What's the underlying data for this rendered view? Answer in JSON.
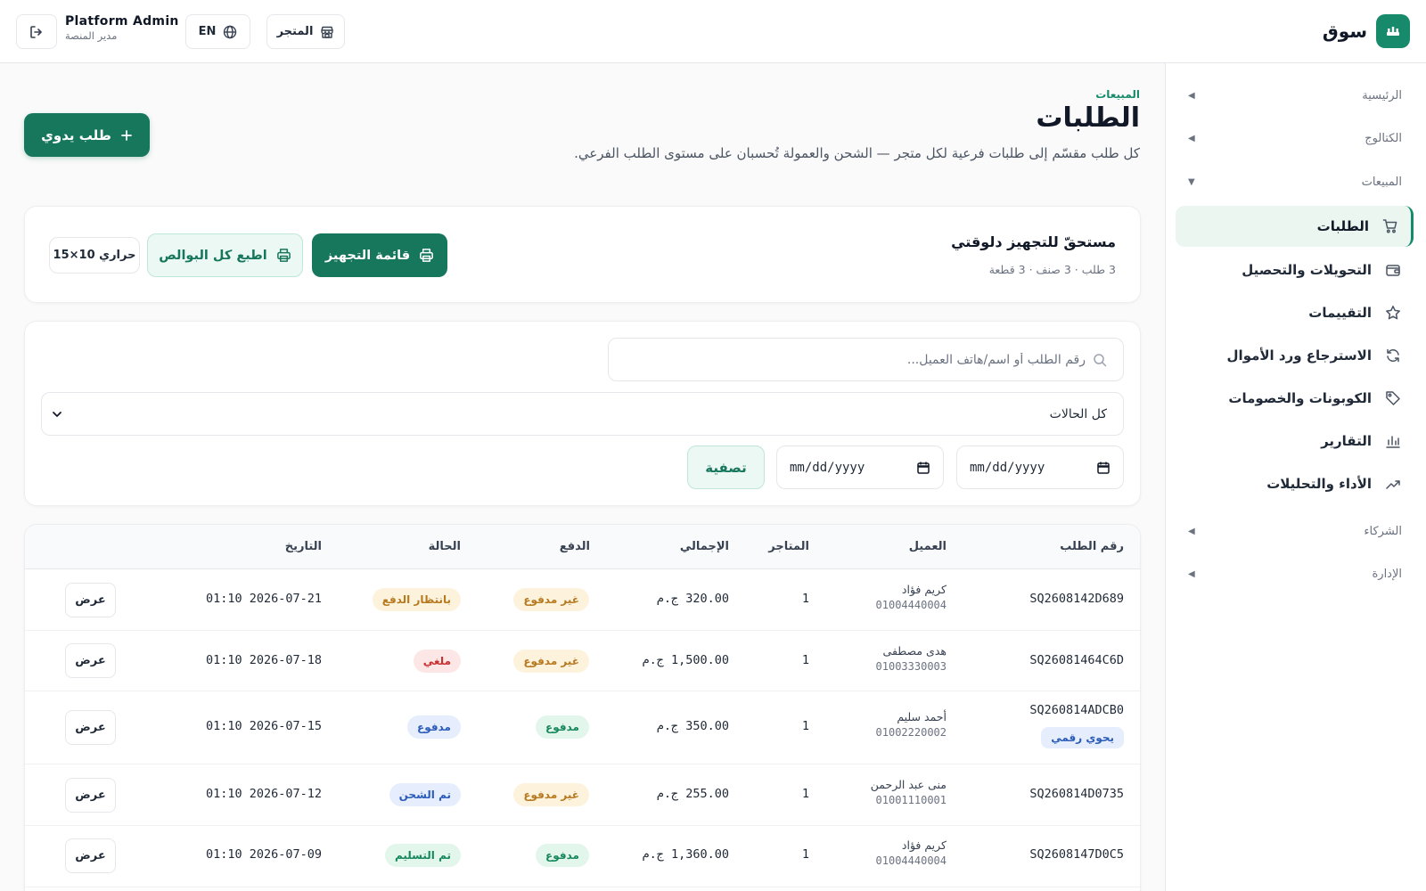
{
  "header": {
    "brand_name": "سوق",
    "store_label": "المتجر",
    "lang_label": "EN",
    "admin_name": "Platform Admin",
    "admin_role": "مدير المنصة"
  },
  "sidebar": {
    "sections": [
      {
        "label": "الرئيسية",
        "caret": "◀"
      },
      {
        "label": "الكتالوج",
        "caret": "◀"
      },
      {
        "label": "المبيعات",
        "caret": "▼"
      },
      {
        "label": "الشركاء",
        "caret": "◀"
      },
      {
        "label": "الإدارة",
        "caret": "◀"
      }
    ],
    "items": [
      {
        "label": "الطلبات",
        "icon": "cart-icon",
        "active": true
      },
      {
        "label": "التحويلات والتحصيل",
        "icon": "wallet-icon"
      },
      {
        "label": "التقييمات",
        "icon": "star-icon"
      },
      {
        "label": "الاسترجاع ورد الأموال",
        "icon": "refresh-icon"
      },
      {
        "label": "الكوبونات والخصومات",
        "icon": "tag-icon"
      },
      {
        "label": "التقارير",
        "icon": "bar-chart-icon"
      },
      {
        "label": "الأداء والتحليلات",
        "icon": "trend-icon"
      }
    ]
  },
  "page": {
    "breadcrumb": "المبيعات",
    "title": "الطلبات",
    "description": "كل طلب مقسّم إلى طلبات فرعية لكل متجر — الشحن والعمولة تُحسبان على مستوى الطلب الفرعي.",
    "new_order_label": "طلب يدوي"
  },
  "prep": {
    "title": "مستحقّ للتجهيز دلوقتي",
    "meta": "3 طلب · 3 صنف · 3 قطعة",
    "list_label": "قائمة التجهيز",
    "print_label": "اطبع كل البوالص",
    "thermal_label": "حراري 10×15"
  },
  "filters": {
    "search_placeholder": "رقم الطلب أو اسم/هاتف العميل...",
    "status_value": "كل الحالات",
    "date_from_placeholder": "mm/dd/yyyy",
    "date_to_placeholder": "mm/dd/yyyy",
    "filter_label": "تصفية"
  },
  "table": {
    "columns": [
      "رقم الطلب",
      "العميل",
      "المتاجر",
      "الإجمالي",
      "الدفع",
      "الحالة",
      "التاريخ"
    ],
    "view_label": "عرض",
    "rows": [
      {
        "id": "SQ2608142D689",
        "customer": "كريم فؤاد",
        "phone": "01004440004",
        "stores": "1",
        "total": "320.00 ج.م",
        "payment": "غير مدفوع",
        "payment_kind": "unpaid",
        "status": "بانتظار الدفع",
        "status_kind": "awaiting",
        "date": "2026-07-21 01:10"
      },
      {
        "id": "SQ26081464C6D",
        "customer": "هدى مصطفى",
        "phone": "01003330003",
        "stores": "1",
        "total": "1,500.00 ج.م",
        "payment": "غير مدفوع",
        "payment_kind": "unpaid",
        "status": "ملغي",
        "status_kind": "cancelled",
        "date": "2026-07-18 01:10"
      },
      {
        "id": "SQ260814ADCB0",
        "tag": "يحوي رقمي",
        "customer": "أحمد سليم",
        "phone": "01002220002",
        "stores": "1",
        "total": "350.00 ج.م",
        "payment": "مدفوع",
        "payment_kind": "paid",
        "status": "مدفوع",
        "status_kind": "paidstatus",
        "date": "2026-07-15 01:10"
      },
      {
        "id": "SQ260814D0735",
        "customer": "منى عبد الرحمن",
        "phone": "01001110001",
        "stores": "1",
        "total": "255.00 ج.م",
        "payment": "غير مدفوع",
        "payment_kind": "unpaid",
        "status": "تم الشحن",
        "status_kind": "shipped",
        "date": "2026-07-12 01:10"
      },
      {
        "id": "SQ2608147D0C5",
        "customer": "كريم فؤاد",
        "phone": "01004440004",
        "stores": "1",
        "total": "1,360.00 ج.م",
        "payment": "مدفوع",
        "payment_kind": "paid",
        "status": "تم التسليم",
        "status_kind": "delivered",
        "date": "2026-07-09 01:10"
      }
    ]
  },
  "colors": {
    "brand": "#178a6b",
    "brand_dark": "#16775c",
    "brand_soft": "#ecf8f3"
  }
}
